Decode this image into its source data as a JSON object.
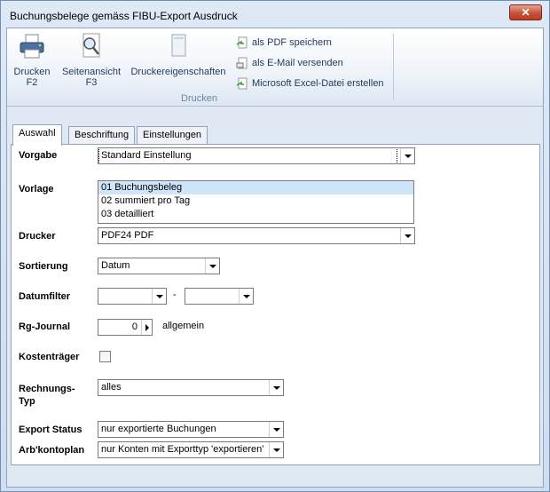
{
  "window": {
    "title": "Buchungsbelege gemäss FIBU-Export Ausdruck",
    "close_label": "✕"
  },
  "ribbon": {
    "print_label_1": "Drucken",
    "print_label_2": "F2",
    "preview_label_1": "Seitenansicht",
    "preview_label_2": "F3",
    "props_label": "Druckereigenschaften",
    "group_label": "Drucken",
    "links": [
      {
        "label": "als PDF speichern",
        "icon": "pdf-export-icon"
      },
      {
        "label": "als E-Mail versenden",
        "icon": "email-icon"
      },
      {
        "label": "Microsoft Excel-Datei erstellen",
        "icon": "excel-export-icon"
      }
    ]
  },
  "tabs": [
    "Auswahl",
    "Beschriftung",
    "Einstellungen"
  ],
  "form": {
    "vorgabe": {
      "label": "Vorgabe",
      "value": "Standard Einstellung"
    },
    "vorlage": {
      "label": "Vorlage",
      "items": [
        "01 Buchungsbeleg",
        "02 summiert pro Tag",
        "03 detailliert"
      ],
      "selected_index": 0
    },
    "drucker": {
      "label": "Drucker",
      "value": "PDF24 PDF"
    },
    "sortierung": {
      "label": "Sortierung",
      "value": "Datum"
    },
    "datumfilter": {
      "label": "Datumfilter",
      "from": "",
      "to": "",
      "separator": "-"
    },
    "rg_journal": {
      "label": "Rg-Journal",
      "value": "0",
      "suffix": "allgemein"
    },
    "kostentraeger": {
      "label": "Kostenträger",
      "checked": false
    },
    "rechnungs_typ": {
      "label_1": "Rechnungs-",
      "label_2": "Typ",
      "value": "alles"
    },
    "export_status": {
      "label": "Export Status",
      "value": "nur exportierte Buchungen"
    },
    "kontoplan": {
      "label": "Arb'kontoplan",
      "value": "nur Konten mit Exporttyp 'exportieren'"
    }
  }
}
